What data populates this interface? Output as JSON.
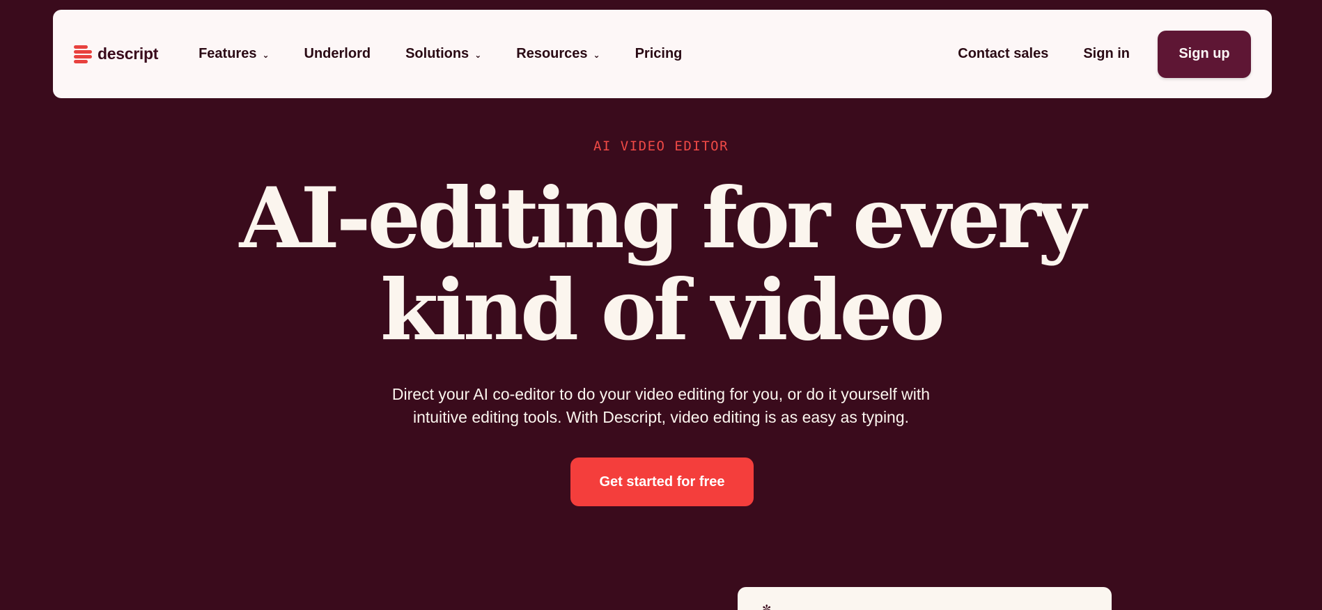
{
  "brand": {
    "name": "descript",
    "accent": "#e8413e",
    "background": "#3a0b1c"
  },
  "nav": {
    "items": [
      {
        "label": "Features",
        "has_dropdown": true
      },
      {
        "label": "Underlord",
        "has_dropdown": false
      },
      {
        "label": "Solutions",
        "has_dropdown": true
      },
      {
        "label": "Resources",
        "has_dropdown": true
      },
      {
        "label": "Pricing",
        "has_dropdown": false
      }
    ],
    "contact_sales": "Contact sales",
    "sign_in": "Sign in",
    "sign_up": "Sign up"
  },
  "hero": {
    "eyebrow": "AI VIDEO EDITOR",
    "headline_line1": "AI-editing for every",
    "headline_line2": "kind of video",
    "subtitle_line1": "Direct your AI co-editor to do your video editing for you, or do it yourself with",
    "subtitle_line2": "intuitive editing tools. With Descript, video editing is as easy as typing.",
    "cta": "Get started for free"
  },
  "icons": {
    "chevron": "chevron-down-icon",
    "preview": "sparkle-icon"
  }
}
